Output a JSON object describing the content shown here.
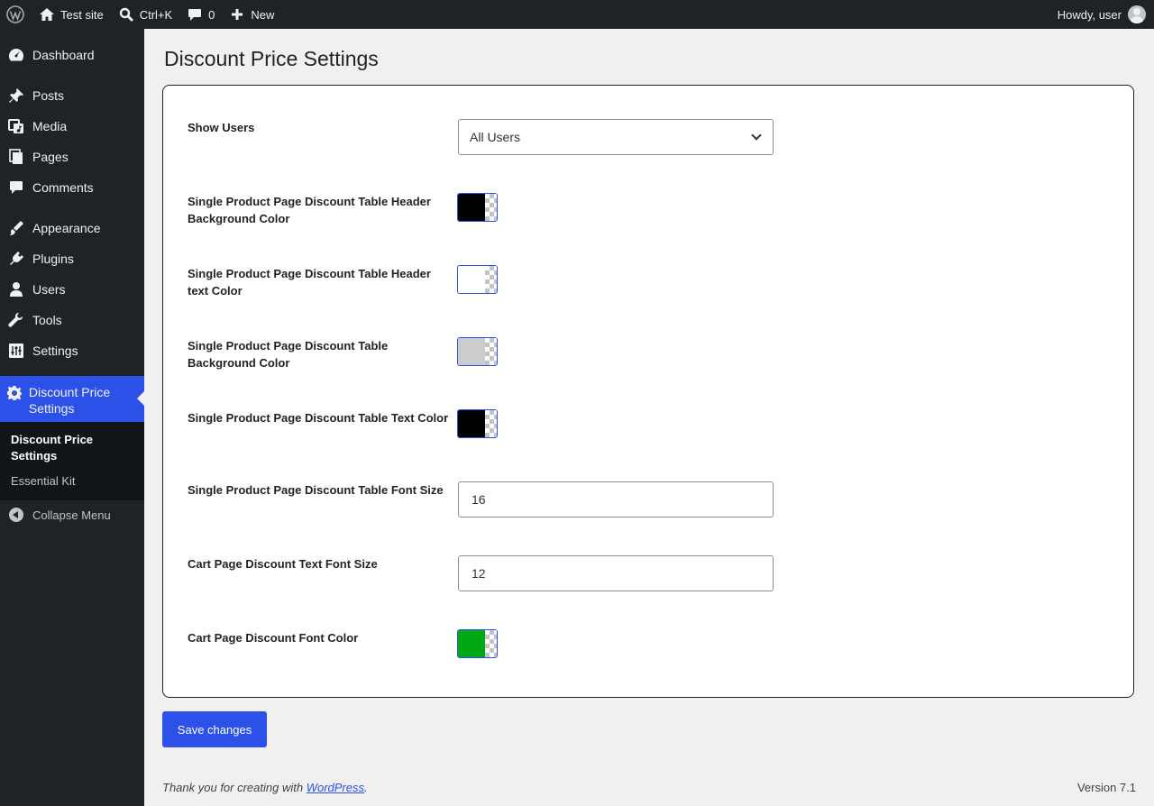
{
  "admin_bar": {
    "site_name": "Test site",
    "search_shortcut": "Ctrl+K",
    "comments_count": "0",
    "new_label": "New",
    "greeting": "Howdy, user"
  },
  "sidebar": {
    "items": [
      {
        "label": "Dashboard",
        "icon": "dashboard-icon"
      },
      {
        "label": "Posts",
        "icon": "pin-icon"
      },
      {
        "label": "Media",
        "icon": "media-icon"
      },
      {
        "label": "Pages",
        "icon": "pages-icon"
      },
      {
        "label": "Comments",
        "icon": "comment-icon"
      },
      {
        "label": "Appearance",
        "icon": "brush-icon"
      },
      {
        "label": "Plugins",
        "icon": "plug-icon"
      },
      {
        "label": "Users",
        "icon": "user-icon"
      },
      {
        "label": "Tools",
        "icon": "wrench-icon"
      },
      {
        "label": "Settings",
        "icon": "sliders-icon"
      },
      {
        "label": "Discount Price Settings",
        "icon": "gear-icon"
      }
    ],
    "submenu": [
      "Discount Price Settings",
      "Essential Kit"
    ],
    "collapse_label": "Collapse Menu"
  },
  "page": {
    "title": "Discount Price Settings",
    "fields": {
      "show_users": {
        "label": "Show Users",
        "value": "All Users"
      },
      "header_bg": {
        "label": "Single Product Page Discount Table Header Background Color",
        "color": "#000000"
      },
      "header_text": {
        "label": "Single Product Page Discount Table Header text Color",
        "color": "#ffffff"
      },
      "table_bg": {
        "label": "Single Product Page Discount Table Background Color",
        "color": "#cccccc"
      },
      "table_text": {
        "label": "Single Product Page Discount Table Text Color",
        "color": "#000000"
      },
      "table_font_size": {
        "label": "Single Product Page Discount Table Font Size",
        "value": "16"
      },
      "cart_font_size": {
        "label": "Cart Page Discount Text Font Size",
        "value": "12"
      },
      "cart_font_color": {
        "label": "Cart Page Discount Font Color",
        "color": "#00a814"
      }
    },
    "save_label": "Save changes"
  },
  "footer": {
    "thanks_prefix": "Thank you for creating with ",
    "link_text": "WordPress",
    "thanks_suffix": ".",
    "version": "Version 7.1"
  },
  "colors": {
    "accent": "#2c51e8",
    "sidebar_bg": "#1d2327",
    "page_bg": "#f0f0f1"
  }
}
